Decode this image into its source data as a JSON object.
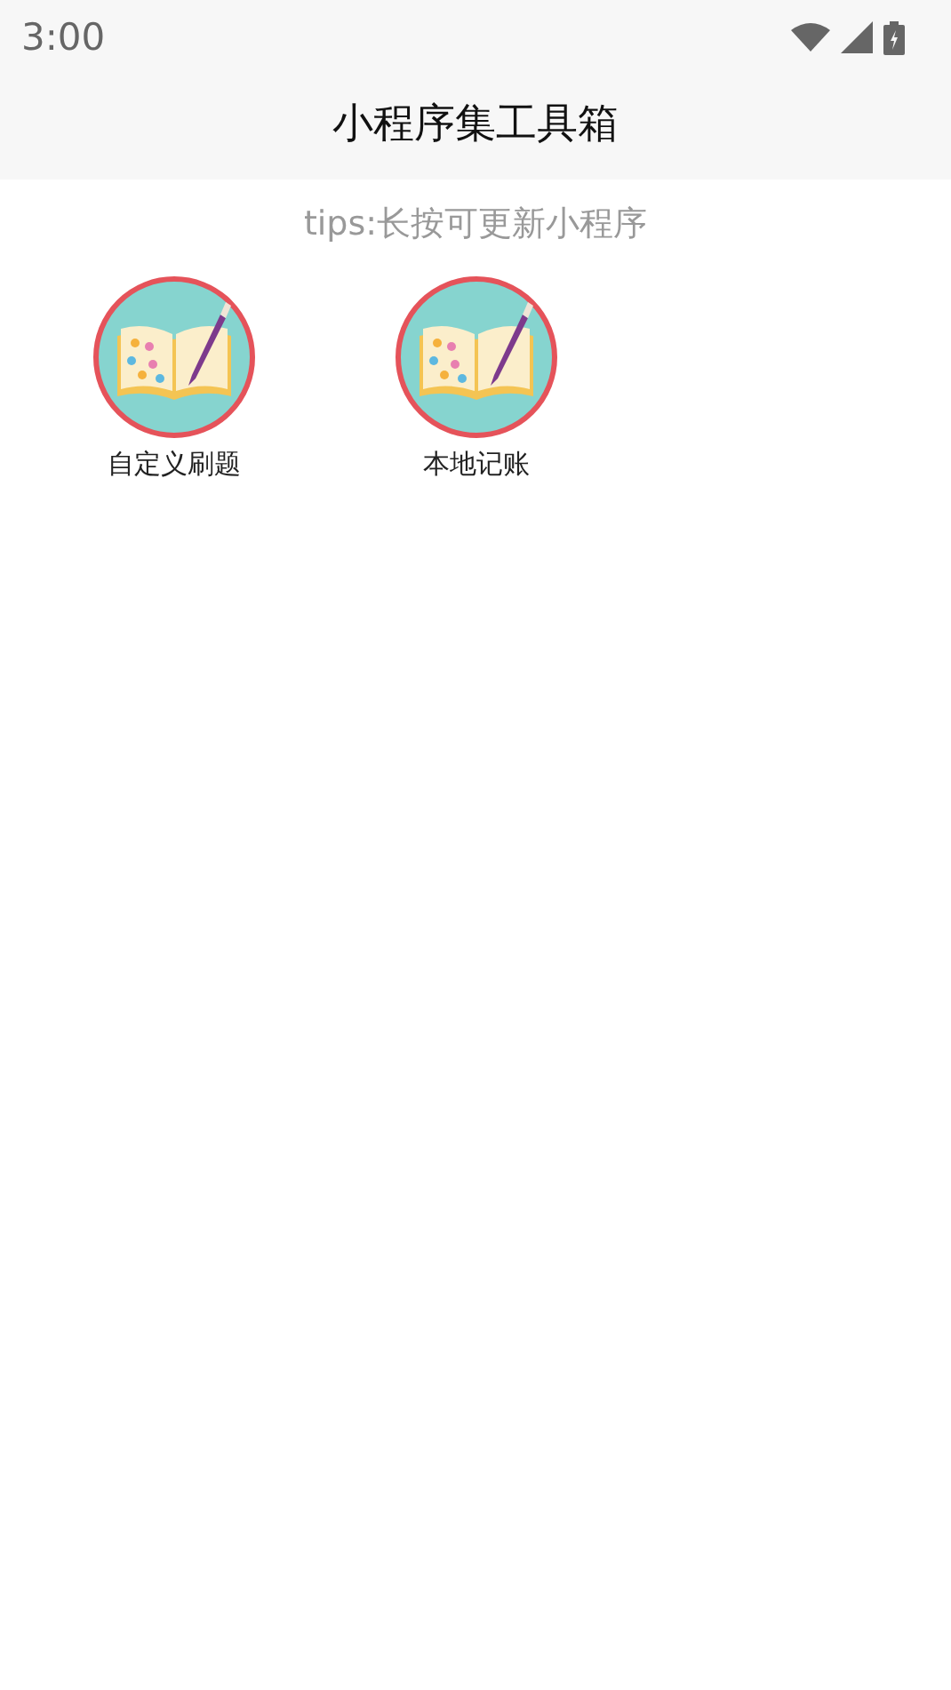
{
  "status_bar": {
    "time": "3:00"
  },
  "app_bar": {
    "title": "小程序集工具箱"
  },
  "tips": "tips:长按可更新小程序",
  "apps": [
    {
      "label": "自定义刷题"
    },
    {
      "label": "本地记账"
    }
  ]
}
